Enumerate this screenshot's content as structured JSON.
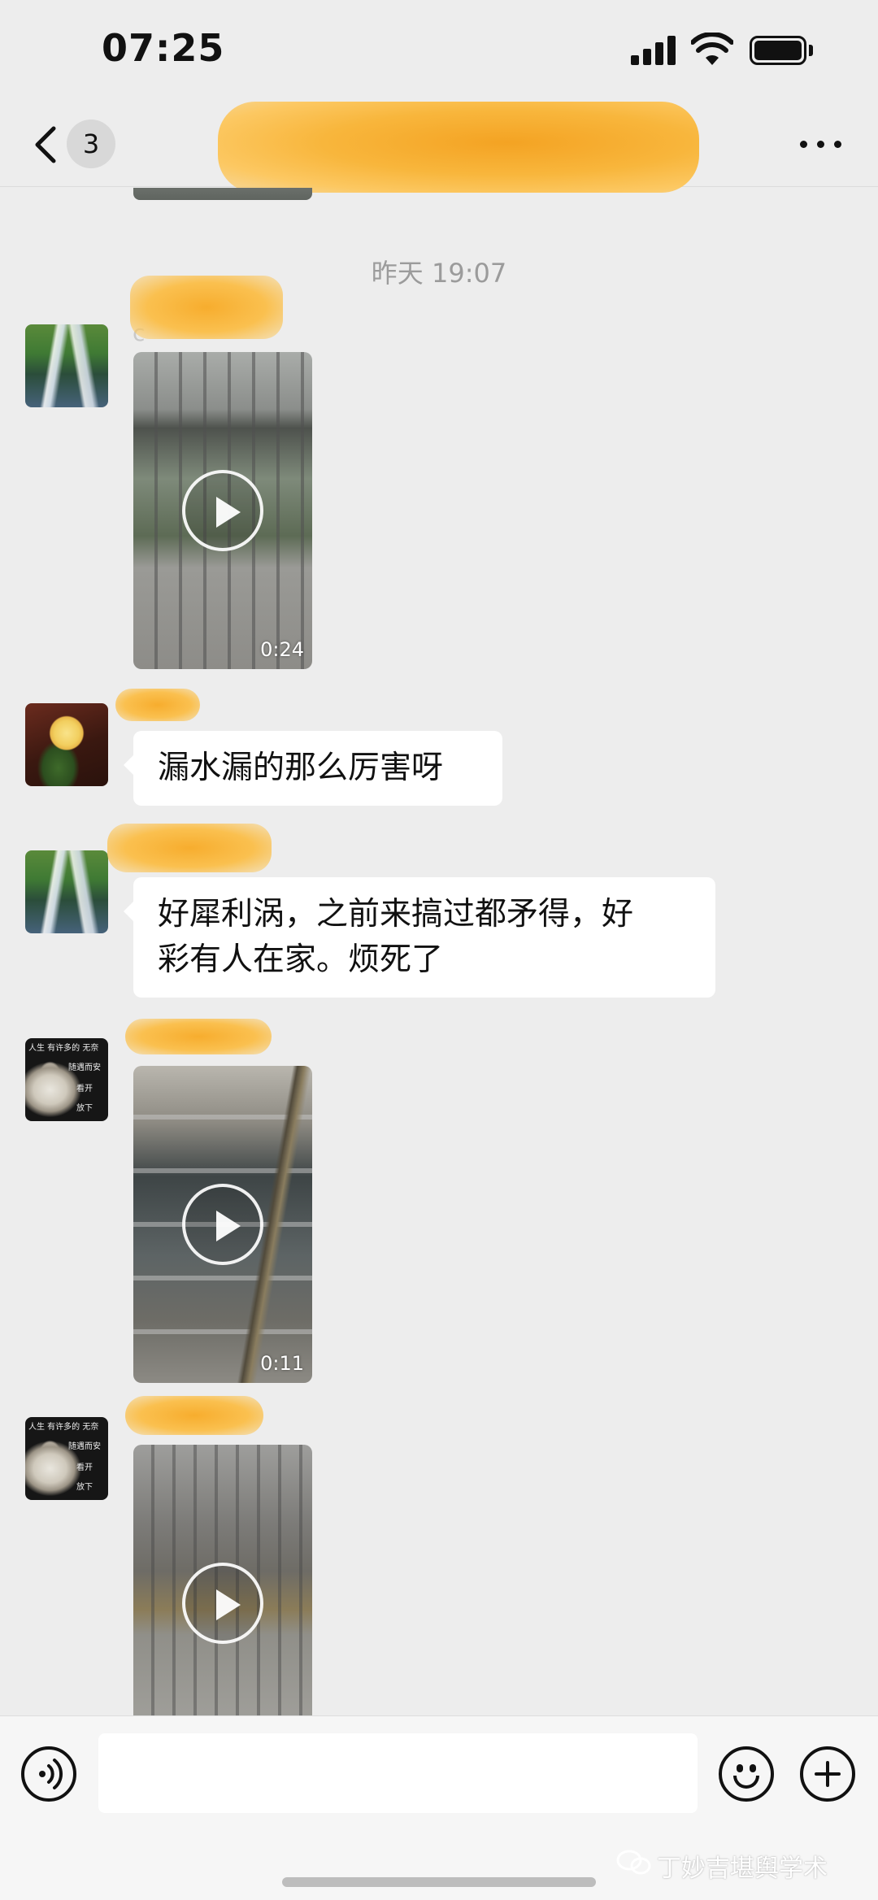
{
  "status_bar": {
    "time": "07:25",
    "icons": [
      "cellular-signal-icon",
      "wifi-icon",
      "battery-icon"
    ]
  },
  "header": {
    "back_icon": "chevron-left-icon",
    "unread_count": "3",
    "title_obscured": true,
    "more_icon": "ellipsis-icon"
  },
  "chat": {
    "timestamp": "昨天 19:07",
    "messages": [
      {
        "type": "video",
        "avatar": "waterfall",
        "sender_faint": "c",
        "duration": "0:24"
      },
      {
        "type": "text",
        "avatar": "rose",
        "text": "漏水漏的那么厉害呀"
      },
      {
        "type": "text",
        "avatar": "waterfall",
        "line1": "好犀利涡，之前来搞过都矛得，好",
        "line2": "彩有人在家。烦死了"
      },
      {
        "type": "video",
        "avatar": "buddha",
        "duration": "0:11"
      },
      {
        "type": "video",
        "avatar": "buddha",
        "duration": ""
      }
    ],
    "buddha_avatar_text": {
      "top": "人生 有许多的 无奈",
      "mid": "随遇而安",
      "open": "看开",
      "down": "放下"
    }
  },
  "input_bar": {
    "voice_icon": "voice-icon",
    "emoji_icon": "emoji-icon",
    "plus_icon": "plus-icon",
    "input_value": ""
  },
  "watermark": {
    "icon": "wechat-icon",
    "text": "丁妙吉堪舆学术"
  },
  "colors": {
    "background": "#ededed",
    "bubble": "#ffffff",
    "redaction": "#f7ad2e",
    "timestamp": "#9b9b9b"
  }
}
